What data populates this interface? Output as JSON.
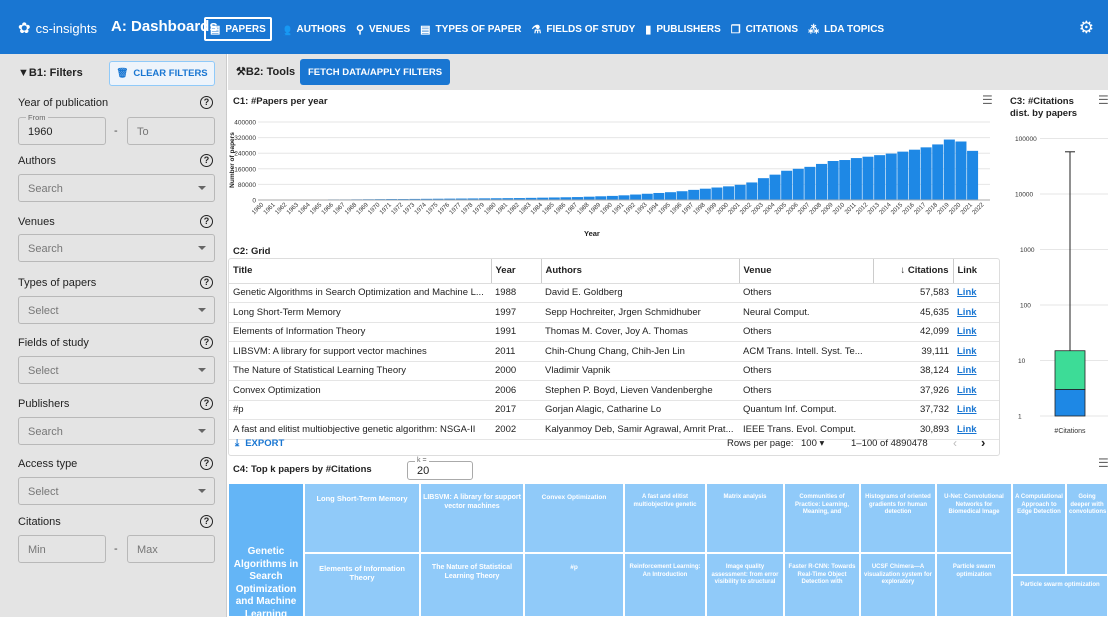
{
  "app": {
    "brand": "cs-insights",
    "dashboard": "A: Dashboards"
  },
  "nav": [
    {
      "icon": "▤",
      "icon_name": "papers-icon",
      "label": "PAPERS",
      "selected": true
    },
    {
      "icon": "👥",
      "icon_name": "authors-icon",
      "label": "AUTHORS"
    },
    {
      "icon": "⚲",
      "icon_name": "location-pin-icon",
      "label": "VENUES"
    },
    {
      "icon": "▤",
      "icon_name": "types-icon",
      "label": "TYPES OF PAPER"
    },
    {
      "icon": "⚗",
      "icon_name": "flask-icon",
      "label": "FIELDS OF STUDY"
    },
    {
      "icon": "▮",
      "icon_name": "book-icon",
      "label": "PUBLISHERS"
    },
    {
      "icon": "❐",
      "icon_name": "citations-icon",
      "label": "CITATIONS"
    },
    {
      "icon": "⁂",
      "icon_name": "topics-icon",
      "label": "LDA TOPICS"
    }
  ],
  "filters": {
    "heading": "B1: Filters",
    "clear_label": "CLEAR FILTERS",
    "year": {
      "label": "Year of publication",
      "from_legend": "From",
      "from_value": "1960",
      "sep": "-",
      "to_placeholder": "To"
    },
    "authors": {
      "label": "Authors",
      "placeholder": "Search"
    },
    "venues": {
      "label": "Venues",
      "placeholder": "Search"
    },
    "types": {
      "label": "Types of papers",
      "placeholder": "Select"
    },
    "fields": {
      "label": "Fields of study",
      "placeholder": "Select"
    },
    "publishers": {
      "label": "Publishers",
      "placeholder": "Search"
    },
    "access": {
      "label": "Access type",
      "placeholder": "Select"
    },
    "citations": {
      "label": "Citations",
      "min_placeholder": "Min",
      "sep": "-",
      "max_placeholder": "Max"
    }
  },
  "tools": {
    "heading": "B2: Tools",
    "fetch_label": "FETCH DATA/APPLY FILTERS"
  },
  "colors": {
    "primary": "#1976d2",
    "bar": "#1e88e5",
    "box_upper": "#3ddc97",
    "tile": "#90caf9",
    "tile_dark": "#64b5f6"
  },
  "chart_data": [
    {
      "type": "bar",
      "title": "C1: #Papers per year",
      "xlabel": "Year",
      "ylabel": "Number of papers",
      "ylim": [
        0,
        400000
      ],
      "yticks": [
        "0",
        "80000",
        "160000",
        "240000",
        "320000",
        "400000"
      ],
      "categories": [
        "1960",
        "1961",
        "1962",
        "1963",
        "1964",
        "1965",
        "1966",
        "1967",
        "1968",
        "1969",
        "1970",
        "1971",
        "1972",
        "1973",
        "1974",
        "1975",
        "1976",
        "1977",
        "1978",
        "1979",
        "1980",
        "1981",
        "1982",
        "1983",
        "1984",
        "1985",
        "1986",
        "1987",
        "1988",
        "1989",
        "1990",
        "1991",
        "1992",
        "1993",
        "1994",
        "1995",
        "1996",
        "1997",
        "1998",
        "1999",
        "2000",
        "2001",
        "2002",
        "2003",
        "2004",
        "2005",
        "2006",
        "2007",
        "2008",
        "2009",
        "2010",
        "2011",
        "2012",
        "2013",
        "2014",
        "2015",
        "2016",
        "2017",
        "2018",
        "2019",
        "2020",
        "2021",
        "2022"
      ],
      "values": [
        1000,
        1000,
        1500,
        2000,
        2000,
        2500,
        3000,
        3000,
        3500,
        4000,
        4500,
        5000,
        5000,
        5500,
        6000,
        6500,
        7000,
        7500,
        8000,
        8500,
        9000,
        9500,
        10000,
        11000,
        12000,
        13000,
        14000,
        15000,
        17000,
        19000,
        21000,
        24000,
        28000,
        32000,
        36000,
        40000,
        45000,
        52000,
        58000,
        64000,
        70000,
        78000,
        90000,
        112000,
        130000,
        150000,
        160000,
        170000,
        185000,
        200000,
        205000,
        215000,
        222000,
        230000,
        238000,
        248000,
        258000,
        270000,
        285000,
        310000,
        300000,
        252000,
        0
      ]
    },
    {
      "type": "box",
      "title": "C3: #Citations dist. by papers",
      "scale": "log",
      "yticks": [
        "1",
        "10",
        "100",
        "1000",
        "10000",
        "100000"
      ],
      "category": "#Citations",
      "min": 1,
      "q1": 1,
      "median": 3,
      "q3": 15,
      "max": 57583
    },
    {
      "type": "treemap",
      "title": "C4: Top k papers by #Citations",
      "k_legend": "k =",
      "k_value": "20",
      "tiles": [
        {
          "label": "Genetic Algorithms in Search Optimization and Machine Learning",
          "value": 57583
        },
        {
          "label": "Long Short-Term Memory",
          "value": 45635
        },
        {
          "label": "Elements of Information Theory",
          "value": 42099
        },
        {
          "label": "LIBSVM: A library for support vector machines",
          "value": 39111
        },
        {
          "label": "The Nature of Statistical Learning Theory",
          "value": 38124
        },
        {
          "label": "Convex Optimization",
          "value": 37926
        },
        {
          "label": "#p",
          "value": 37732
        },
        {
          "label": "A fast and elitist multiobjective genetic",
          "value": 30893
        },
        {
          "label": "Reinforcement Learning: An Introduction",
          "value": 30000
        },
        {
          "label": "Matrix analysis",
          "value": 29000
        },
        {
          "label": "Image quality assessment: from error visibility to structural",
          "value": 28500
        },
        {
          "label": "Communities of Practice: Learning, Meaning, and",
          "value": 28000
        },
        {
          "label": "Faster R-CNN: Towards Real-Time Object Detection with",
          "value": 27500
        },
        {
          "label": "Histograms of oriented gradients for human detection",
          "value": 27000
        },
        {
          "label": "UCSF Chimera—A visualization system for exploratory",
          "value": 26500
        },
        {
          "label": "U-Net: Convolutional Networks for Biomedical Image",
          "value": 26000
        },
        {
          "label": "Particle swarm optimization",
          "value": 25500
        },
        {
          "label": "A Computational Approach to Edge Detection",
          "value": 25000
        },
        {
          "label": "Going deeper with convolutions",
          "value": 24500
        },
        {
          "label": "Particle swarm optimization",
          "value": 24000
        }
      ]
    }
  ],
  "grid": {
    "title": "C2: Grid",
    "columns": [
      "Title",
      "Year",
      "Authors",
      "Venue",
      "Citations",
      "Link"
    ],
    "rows": [
      [
        "Genetic Algorithms in Search Optimization and Machine L...",
        "1988",
        "David E. Goldberg",
        "Others",
        "57,583",
        "Link"
      ],
      [
        "Long Short-Term Memory",
        "1997",
        "Sepp Hochreiter, Jrgen Schmidhuber",
        "Neural Comput.",
        "45,635",
        "Link"
      ],
      [
        "Elements of Information Theory",
        "1991",
        "Thomas M. Cover, Joy A. Thomas",
        "Others",
        "42,099",
        "Link"
      ],
      [
        "LIBSVM: A library for support vector machines",
        "2011",
        "Chih-Chung Chang, Chih-Jen Lin",
        "ACM Trans. Intell. Syst. Te...",
        "39,111",
        "Link"
      ],
      [
        "The Nature of Statistical Learning Theory",
        "2000",
        "Vladimir Vapnik",
        "Others",
        "38,124",
        "Link"
      ],
      [
        "Convex Optimization",
        "2006",
        "Stephen P. Boyd, Lieven Vandenberghe",
        "Others",
        "37,926",
        "Link"
      ],
      [
        "#p",
        "2017",
        "Gorjan Alagic, Catharine Lo",
        "Quantum Inf. Comput.",
        "37,732",
        "Link"
      ],
      [
        "A fast and elitist multiobjective genetic algorithm: NSGA-II",
        "2002",
        "Kalyanmoy Deb, Samir Agrawal, Amrit Prat...",
        "IEEE Trans. Evol. Comput.",
        "30,893",
        "Link"
      ]
    ],
    "export_label": "EXPORT",
    "rows_per_page_label": "Rows per page:",
    "rows_per_page": "100",
    "range": "1–100 of 4890478"
  }
}
